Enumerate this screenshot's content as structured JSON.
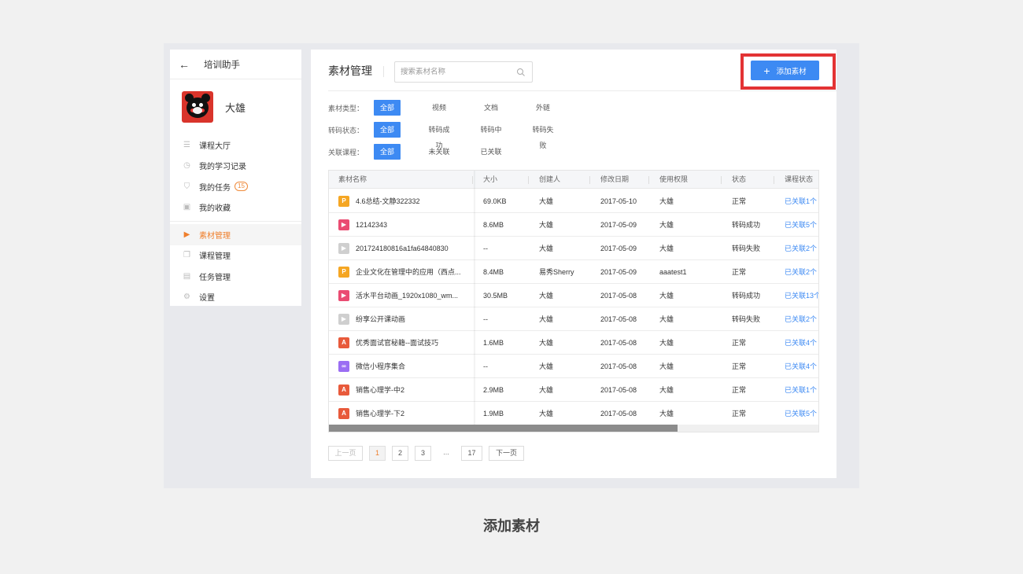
{
  "sidebar": {
    "title": "培训助手",
    "username": "大雄",
    "items": [
      {
        "label": "课程大厅",
        "icon": "list-icon",
        "glyph": "☰"
      },
      {
        "label": "我的学习记录",
        "icon": "clock-icon",
        "glyph": "◷"
      },
      {
        "label": "我的任务",
        "icon": "shield-icon",
        "glyph": "⛉",
        "badge": "15"
      },
      {
        "label": "我的收藏",
        "icon": "folder-star-icon",
        "glyph": "▣"
      },
      {
        "label": "素材管理",
        "icon": "media-icon",
        "glyph": "▶",
        "active": true
      },
      {
        "label": "课程管理",
        "icon": "copy-icon",
        "glyph": "❐"
      },
      {
        "label": "任务管理",
        "icon": "task-icon",
        "glyph": "▤"
      },
      {
        "label": "设置",
        "icon": "gear-icon",
        "glyph": "⚙"
      }
    ]
  },
  "header": {
    "title": "素材管理",
    "search_placeholder": "搜索素材名称",
    "add_button": "添加素材"
  },
  "filters": [
    {
      "label": "素材类型：",
      "options": [
        "全部",
        "视频",
        "文档",
        "外链"
      ],
      "selected": 0
    },
    {
      "label": "转码状态：",
      "options": [
        "全部",
        "转码成功",
        "转码中",
        "转码失败"
      ],
      "selected": 0
    },
    {
      "label": "关联课程：",
      "options": [
        "全部",
        "未关联",
        "已关联"
      ],
      "selected": 0
    }
  ],
  "table": {
    "columns": [
      "素材名称",
      "大小",
      "创建人",
      "修改日期",
      "使用权限",
      "状态",
      "课程状态"
    ],
    "rows": [
      {
        "type": "ppt",
        "glyph": "P",
        "name": "4.6总结-文静322332",
        "size": "69.0KB",
        "creator": "大雄",
        "date": "2017-05-10",
        "perm": "大雄",
        "status": "正常",
        "course": "已关联1个"
      },
      {
        "type": "video",
        "glyph": "▶",
        "name": "12142343",
        "size": "8.6MB",
        "creator": "大雄",
        "date": "2017-05-09",
        "perm": "大雄",
        "status": "转码成功",
        "course": "已关联5个"
      },
      {
        "type": "gray",
        "glyph": "▶",
        "name": "201724180816a1fa64840830",
        "size": "--",
        "creator": "大雄",
        "date": "2017-05-09",
        "perm": "大雄",
        "status": "转码失败",
        "course": "已关联2个"
      },
      {
        "type": "ppt",
        "glyph": "P",
        "name": "企业文化在管理中的应用（西点...",
        "size": "8.4MB",
        "creator": "易秀Sherry",
        "date": "2017-05-09",
        "perm": "aaatest1",
        "status": "正常",
        "course": "已关联2个"
      },
      {
        "type": "video",
        "glyph": "▶",
        "name": "活水平台动画_1920x1080_wm...",
        "size": "30.5MB",
        "creator": "大雄",
        "date": "2017-05-08",
        "perm": "大雄",
        "status": "转码成功",
        "course": "已关联13个"
      },
      {
        "type": "gray",
        "glyph": "▶",
        "name": "纷享公开课动画",
        "size": "--",
        "creator": "大雄",
        "date": "2017-05-08",
        "perm": "大雄",
        "status": "转码失败",
        "course": "已关联2个"
      },
      {
        "type": "pdf",
        "glyph": "A",
        "name": "优秀面试官秘籍--面试技巧",
        "size": "1.6MB",
        "creator": "大雄",
        "date": "2017-05-08",
        "perm": "大雄",
        "status": "正常",
        "course": "已关联4个"
      },
      {
        "type": "link",
        "glyph": "∞",
        "name": "微信小程序集合",
        "size": "--",
        "creator": "大雄",
        "date": "2017-05-08",
        "perm": "大雄",
        "status": "正常",
        "course": "已关联4个"
      },
      {
        "type": "pdf",
        "glyph": "A",
        "name": "销售心理学-中2",
        "size": "2.9MB",
        "creator": "大雄",
        "date": "2017-05-08",
        "perm": "大雄",
        "status": "正常",
        "course": "已关联1个"
      },
      {
        "type": "pdf",
        "glyph": "A",
        "name": "销售心理学-下2",
        "size": "1.9MB",
        "creator": "大雄",
        "date": "2017-05-08",
        "perm": "大雄",
        "status": "正常",
        "course": "已关联5个"
      }
    ]
  },
  "pagination": {
    "prev": "上一页",
    "pages": [
      "1",
      "2",
      "3",
      "...",
      "17"
    ],
    "current": "1",
    "next": "下一页"
  },
  "caption": "添加素材",
  "colors": {
    "accent": "#3d8af3",
    "active": "#ef7f2c",
    "highlight": "#e33334"
  }
}
